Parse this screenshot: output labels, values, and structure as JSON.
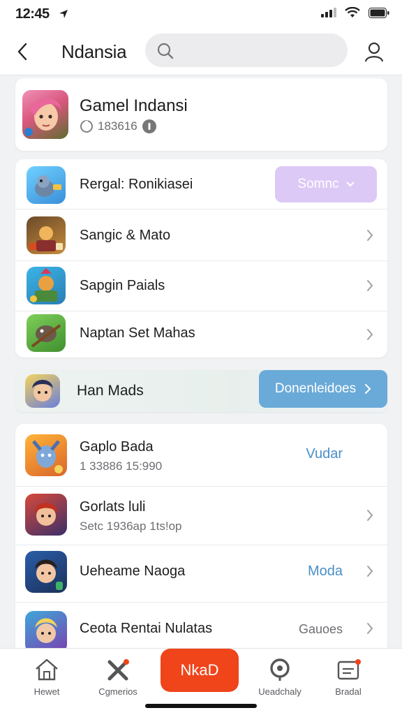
{
  "status": {
    "time": "12:45"
  },
  "nav": {
    "title": "Ndansia",
    "search_placeholder": ""
  },
  "featured": {
    "title": "Gamel Indansi",
    "meta": "183616"
  },
  "list1": {
    "items": [
      {
        "label": "Rergal: Ronikiasei",
        "action": "Somnc"
      },
      {
        "label": "Sangic & Mato"
      },
      {
        "label": "Sapgin Paials"
      },
      {
        "label": "Naptan Set Mahas"
      }
    ]
  },
  "banner": {
    "label": "Han Mads",
    "button": "Donenleidoes"
  },
  "list2": {
    "items": [
      {
        "title": "Gaplo Bada",
        "sub": "1 33886 15:990",
        "action": "Vudar"
      },
      {
        "title": "Gorlats luli",
        "sub": "Setc 1936ap 1ts!op",
        "action": ""
      },
      {
        "title": "Ueheame Naoga",
        "sub": "",
        "action": "Moda"
      },
      {
        "title": "Ceota Rentai Nulatas",
        "sub": "",
        "action": "Gauoes"
      }
    ]
  },
  "tabs": [
    {
      "label": "Hewet"
    },
    {
      "label": "Cgmerios"
    },
    {
      "label": "NkaD"
    },
    {
      "label": "Ueadchaly"
    },
    {
      "label": "Bradal"
    }
  ],
  "colors": {
    "accent_orange": "#f0441a",
    "accent_blue": "#6aaad8",
    "accent_purple": "#ddc9f5",
    "link_blue": "#4a8fc8"
  }
}
